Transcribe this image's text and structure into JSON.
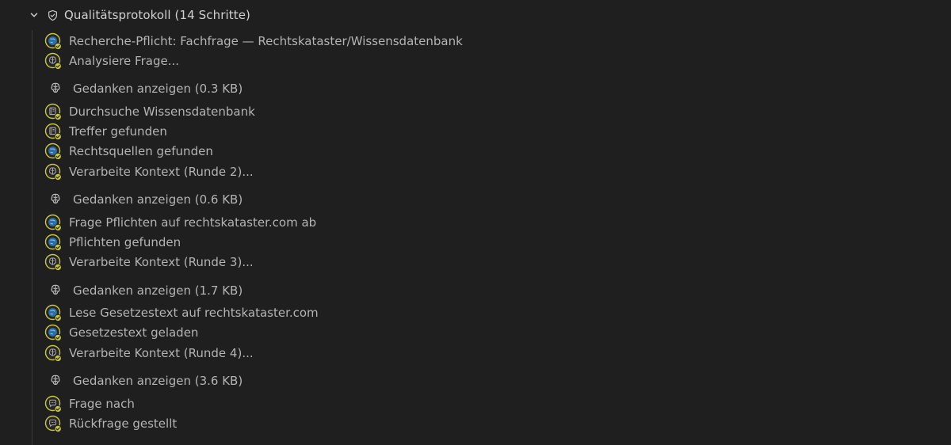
{
  "protocol": {
    "title": "Qualitätsprotokoll (14 Schritte)",
    "expanded": true
  },
  "colors": {
    "background": "#1f1f1f",
    "accent_check": "#c9c83a",
    "globe_blue": "#2a6fa8",
    "text": "#b4b4b4"
  },
  "entries": [
    {
      "kind": "step",
      "icon": "globe-check-icon",
      "label": "Recherche-Pflicht: Fachfrage — Rechtskataster/Wissensdatenbank"
    },
    {
      "kind": "step",
      "icon": "brain-check-icon",
      "label": "Analysiere Frage..."
    },
    {
      "kind": "thought",
      "icon": "brain-icon",
      "label": "Gedanken anzeigen (0.3 KB)"
    },
    {
      "kind": "step",
      "icon": "book-check-icon",
      "label": "Durchsuche Wissensdatenbank"
    },
    {
      "kind": "step",
      "icon": "book-check-icon",
      "label": "Treffer gefunden"
    },
    {
      "kind": "step",
      "icon": "globe-check-icon",
      "label": "Rechtsquellen gefunden"
    },
    {
      "kind": "step",
      "icon": "brain-check-icon",
      "label": "Verarbeite Kontext (Runde 2)..."
    },
    {
      "kind": "thought",
      "icon": "brain-icon",
      "label": "Gedanken anzeigen (0.6 KB)"
    },
    {
      "kind": "step",
      "icon": "globe-check-icon",
      "label": "Frage Pflichten auf rechtskataster.com ab"
    },
    {
      "kind": "step",
      "icon": "globe-check-icon",
      "label": "Pflichten gefunden"
    },
    {
      "kind": "step",
      "icon": "brain-check-icon",
      "label": "Verarbeite Kontext (Runde 3)..."
    },
    {
      "kind": "thought",
      "icon": "brain-icon",
      "label": "Gedanken anzeigen (1.7 KB)"
    },
    {
      "kind": "step",
      "icon": "globe-check-icon",
      "label": "Lese Gesetzestext auf rechtskataster.com"
    },
    {
      "kind": "step",
      "icon": "globe-check-icon",
      "label": "Gesetzestext geladen"
    },
    {
      "kind": "step",
      "icon": "brain-check-icon",
      "label": "Verarbeite Kontext (Runde 4)..."
    },
    {
      "kind": "thought",
      "icon": "brain-icon",
      "label": "Gedanken anzeigen (3.6 KB)"
    },
    {
      "kind": "step",
      "icon": "chat-check-icon",
      "label": "Frage nach"
    },
    {
      "kind": "step",
      "icon": "chat-check-icon",
      "label": "Rückfrage gestellt"
    }
  ]
}
